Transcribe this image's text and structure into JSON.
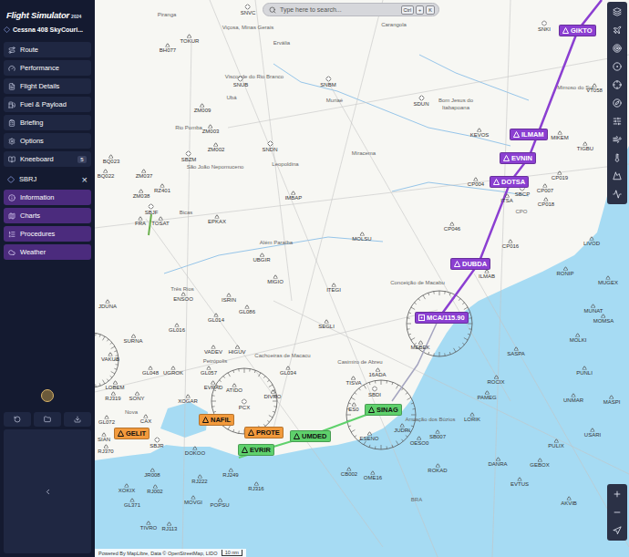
{
  "app": {
    "title": "Flight Simulator",
    "edition": "2024"
  },
  "aircraft": {
    "name": "Cessna 408 SkyCouri..."
  },
  "sidebar": {
    "items": [
      {
        "label": "Route"
      },
      {
        "label": "Performance"
      },
      {
        "label": "Flight Details"
      },
      {
        "label": "Fuel & Payload"
      },
      {
        "label": "Briefing"
      },
      {
        "label": "Options"
      },
      {
        "label": "Kneeboard",
        "badge": "5"
      }
    ]
  },
  "airport": {
    "code": "SBRJ",
    "close": "×",
    "tabs": [
      {
        "label": "Information"
      },
      {
        "label": "Charts"
      },
      {
        "label": "Procedures"
      },
      {
        "label": "Weather"
      }
    ]
  },
  "search": {
    "placeholder": "Type here to search...",
    "shortcut": [
      "Ctrl",
      "+",
      "K"
    ]
  },
  "map": {
    "labels": [
      {
        "text": "Piranga",
        "kind": "place"
      },
      {
        "text": "SNVC",
        "kind": "airport"
      },
      {
        "text": "Viçosa, Minas Gerais",
        "kind": "place"
      },
      {
        "text": "Ervália",
        "kind": "place"
      },
      {
        "text": "Carangola",
        "kind": "place"
      },
      {
        "text": "SNKI",
        "kind": "airport"
      },
      {
        "text": "TOKUR",
        "kind": "fix"
      },
      {
        "text": "BH077",
        "kind": "fix"
      },
      {
        "text": "Visconde do Rio Branco",
        "kind": "place"
      },
      {
        "text": "SNUB",
        "kind": "airport"
      },
      {
        "text": "Ubá",
        "kind": "place"
      },
      {
        "text": "SNBM",
        "kind": "airport"
      },
      {
        "text": "Muriaé",
        "kind": "place"
      },
      {
        "text": "Mimoso do Sul",
        "kind": "place"
      },
      {
        "text": "VT058",
        "kind": "fix"
      },
      {
        "text": "SDUN",
        "kind": "airport"
      },
      {
        "text": "Bom Jesus do",
        "kind": "place"
      },
      {
        "text": "Itabapoana",
        "kind": "place"
      },
      {
        "text": "ZM009",
        "kind": "fix"
      },
      {
        "text": "Rio Pomba",
        "kind": "place"
      },
      {
        "text": "ZM003",
        "kind": "fix"
      },
      {
        "text": "KEVOS",
        "kind": "fix"
      },
      {
        "text": "MIKEM",
        "kind": "fix"
      },
      {
        "text": "ZM002",
        "kind": "fix"
      },
      {
        "text": "SNDN",
        "kind": "airport"
      },
      {
        "text": "TIGBU",
        "kind": "fix"
      },
      {
        "text": "Miracema",
        "kind": "place"
      },
      {
        "text": "BQ023",
        "kind": "fix"
      },
      {
        "text": "SBZM",
        "kind": "airport"
      },
      {
        "text": "São João Nepomuceno",
        "kind": "place"
      },
      {
        "text": "Leopoldina",
        "kind": "place"
      },
      {
        "text": "BQ022",
        "kind": "fix"
      },
      {
        "text": "ZM037",
        "kind": "fix"
      },
      {
        "text": "CP019",
        "kind": "fix"
      },
      {
        "text": "CP004",
        "kind": "fix"
      },
      {
        "text": "RZ401",
        "kind": "fix"
      },
      {
        "text": "CP007",
        "kind": "fix"
      },
      {
        "text": "SBCP",
        "kind": "airport"
      },
      {
        "text": "ZM038",
        "kind": "fix"
      },
      {
        "text": "IMBAP",
        "kind": "fix"
      },
      {
        "text": "ITSA",
        "kind": "fix"
      },
      {
        "text": "CP018",
        "kind": "fix"
      },
      {
        "text": "CPO",
        "kind": "place"
      },
      {
        "text": "SBJF",
        "kind": "airport"
      },
      {
        "text": "Bicas",
        "kind": "place"
      },
      {
        "text": "FRA",
        "kind": "fix"
      },
      {
        "text": "TOSAT",
        "kind": "fix"
      },
      {
        "text": "EPKAX",
        "kind": "fix"
      },
      {
        "text": "CP046",
        "kind": "fix"
      },
      {
        "text": "MOLSU",
        "kind": "fix"
      },
      {
        "text": "Além Paraíba",
        "kind": "place"
      },
      {
        "text": "CP016",
        "kind": "fix"
      },
      {
        "text": "LIVOD",
        "kind": "fix"
      },
      {
        "text": "UBGIR",
        "kind": "fix"
      },
      {
        "text": "RONIP",
        "kind": "fix"
      },
      {
        "text": "ILMAB",
        "kind": "fix"
      },
      {
        "text": "MIGIO",
        "kind": "fix"
      },
      {
        "text": "Conceição de Macabu",
        "kind": "place"
      },
      {
        "text": "MUGEX",
        "kind": "fix"
      },
      {
        "text": "Três Rios",
        "kind": "place"
      },
      {
        "text": "ITEGI",
        "kind": "fix"
      },
      {
        "text": "ENSOO",
        "kind": "fix"
      },
      {
        "text": "ISRIN",
        "kind": "fix"
      },
      {
        "text": "JDUNA",
        "kind": "fix"
      },
      {
        "text": "MUNAT",
        "kind": "fix"
      },
      {
        "text": "GL086",
        "kind": "fix"
      },
      {
        "text": "GL014",
        "kind": "fix"
      },
      {
        "text": "MOMSA",
        "kind": "fix"
      },
      {
        "text": "SEGLI",
        "kind": "fix"
      },
      {
        "text": "GL016",
        "kind": "fix"
      },
      {
        "text": "SURNA",
        "kind": "fix"
      },
      {
        "text": "MOLKI",
        "kind": "fix"
      },
      {
        "text": "MEBEK",
        "kind": "fix"
      },
      {
        "text": "VADEV",
        "kind": "fix"
      },
      {
        "text": "HIGUV",
        "kind": "fix"
      },
      {
        "text": "SASPA",
        "kind": "fix"
      },
      {
        "text": "Cachoeiras de Macacu",
        "kind": "place"
      },
      {
        "text": "VAKUB",
        "kind": "fix"
      },
      {
        "text": "Casimiro de Abreu",
        "kind": "place"
      },
      {
        "text": "Petrópolis",
        "kind": "place"
      },
      {
        "text": "GL057",
        "kind": "fix"
      },
      {
        "text": "GL048",
        "kind": "fix"
      },
      {
        "text": "UGROK",
        "kind": "fix"
      },
      {
        "text": "PUNLI",
        "kind": "fix"
      },
      {
        "text": "GL034",
        "kind": "fix"
      },
      {
        "text": "16ADA",
        "kind": "fix"
      },
      {
        "text": "ROCIX",
        "kind": "fix"
      },
      {
        "text": "TISVA",
        "kind": "fix"
      },
      {
        "text": "EVRAD",
        "kind": "fix"
      },
      {
        "text": "LOBEM",
        "kind": "fix"
      },
      {
        "text": "ATIDO",
        "kind": "fix"
      },
      {
        "text": "SBDI",
        "kind": "airport"
      },
      {
        "text": "DIVRO",
        "kind": "fix"
      },
      {
        "text": "PAMEG",
        "kind": "fix"
      },
      {
        "text": "RJ319",
        "kind": "fix"
      },
      {
        "text": "SONY",
        "kind": "fix"
      },
      {
        "text": "UNMAR",
        "kind": "fix"
      },
      {
        "text": "MASPI",
        "kind": "fix"
      },
      {
        "text": "XOGAR",
        "kind": "fix"
      },
      {
        "text": "PCX",
        "kind": "airport"
      },
      {
        "text": "ES0",
        "kind": "fix"
      },
      {
        "text": "Armação dos Búzios",
        "kind": "place"
      },
      {
        "text": "LORIK",
        "kind": "fix"
      },
      {
        "text": "GL072",
        "kind": "fix"
      },
      {
        "text": "CAX",
        "kind": "fix"
      },
      {
        "text": "Nova",
        "kind": "place"
      },
      {
        "text": "USARI",
        "kind": "fix"
      },
      {
        "text": "JUDRI",
        "kind": "fix"
      },
      {
        "text": "SIAN",
        "kind": "fix"
      },
      {
        "text": "SBJR",
        "kind": "airport"
      },
      {
        "text": "SB007",
        "kind": "fix"
      },
      {
        "text": "ESENO",
        "kind": "fix"
      },
      {
        "text": "OESO0",
        "kind": "fix"
      },
      {
        "text": "PULIX",
        "kind": "fix"
      },
      {
        "text": "RJ370",
        "kind": "fix"
      },
      {
        "text": "DOKOO",
        "kind": "fix"
      },
      {
        "text": "DANRA",
        "kind": "fix"
      },
      {
        "text": "GEBOX",
        "kind": "fix"
      },
      {
        "text": "ROKAD",
        "kind": "fix"
      },
      {
        "text": "CB002",
        "kind": "fix"
      },
      {
        "text": "JR008",
        "kind": "fix"
      },
      {
        "text": "RJ249",
        "kind": "fix"
      },
      {
        "text": "OME16",
        "kind": "fix"
      },
      {
        "text": "RJ222",
        "kind": "fix"
      },
      {
        "text": "EVTUS",
        "kind": "fix"
      },
      {
        "text": "RJ316",
        "kind": "fix"
      },
      {
        "text": "XOKIX",
        "kind": "fix"
      },
      {
        "text": "RJ002",
        "kind": "fix"
      },
      {
        "text": "BRA",
        "kind": "place"
      },
      {
        "text": "MOVGI",
        "kind": "fix"
      },
      {
        "text": "AKVIB",
        "kind": "fix"
      },
      {
        "text": "GL371",
        "kind": "fix"
      },
      {
        "text": "POPSU",
        "kind": "fix"
      },
      {
        "text": "TIVRO",
        "kind": "fix"
      },
      {
        "text": "RJ113",
        "kind": "fix"
      }
    ],
    "waypoints": [
      {
        "name": "GIKTO",
        "kind": "fix",
        "color": "#8b3fd1"
      },
      {
        "name": "ILMAM",
        "kind": "fix",
        "color": "#8b3fd1"
      },
      {
        "name": "EVNIN",
        "kind": "fix",
        "color": "#8b3fd1"
      },
      {
        "name": "DOTSA",
        "kind": "fix",
        "color": "#8b3fd1"
      },
      {
        "name": "DUBDA",
        "kind": "fix",
        "color": "#8b3fd1"
      },
      {
        "name": "MCA/115.90",
        "kind": "navaid",
        "color": "#8b3fd1"
      },
      {
        "name": "SINAG",
        "kind": "fix",
        "color": "#5fd16c"
      },
      {
        "name": "UMDED",
        "kind": "fix",
        "color": "#5fd16c"
      },
      {
        "name": "EVRIR",
        "kind": "fix",
        "color": "#5fd16c"
      },
      {
        "name": "NAFIL",
        "kind": "fix",
        "color": "#f29a3c"
      },
      {
        "name": "PROTE",
        "kind": "fix",
        "color": "#f29a3c"
      },
      {
        "name": "GELIT",
        "kind": "fix",
        "color": "#f29a3c"
      }
    ]
  },
  "attribution": {
    "text": "Powered By MapLibre, Data © OpenStreetMap, LIDO",
    "scale": "10 nm"
  }
}
